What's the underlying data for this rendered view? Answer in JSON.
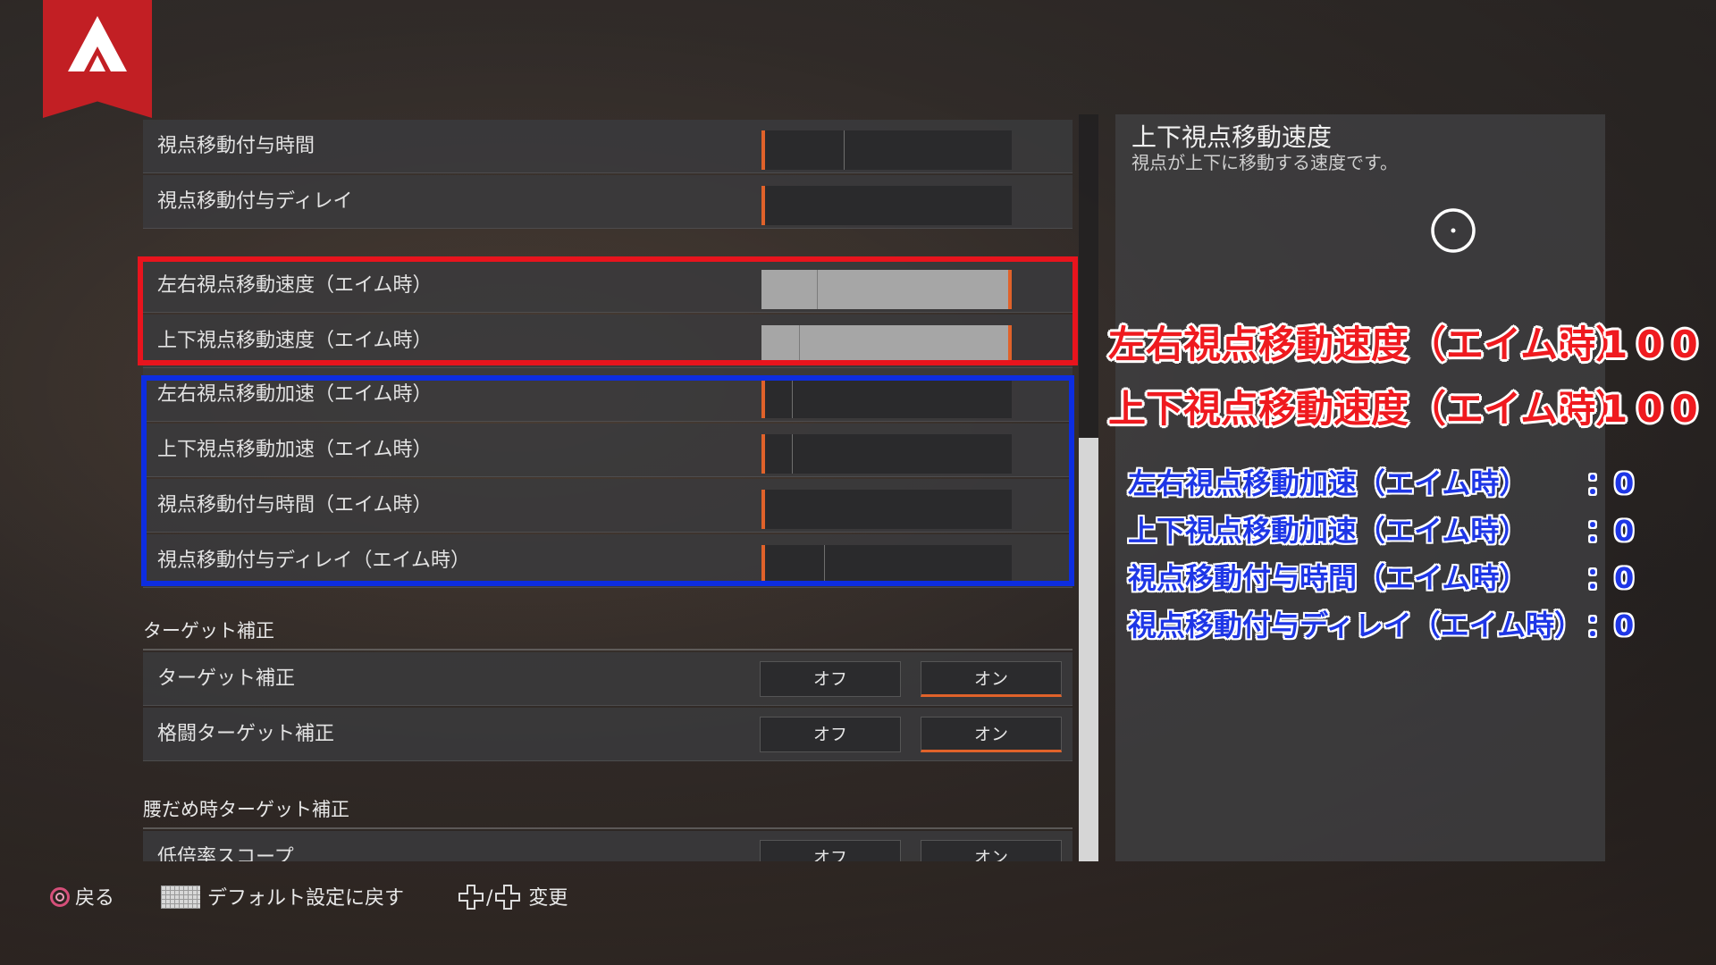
{
  "rows_top": [
    {
      "label": "視点移動付与時間",
      "value_pct": 0,
      "tick_pct": 33
    },
    {
      "label": "視点移動付与ディレイ",
      "value_pct": 0,
      "tick_pct": null
    }
  ],
  "rows_red": [
    {
      "label": "左右視点移動速度（エイム時）",
      "value_pct": 100,
      "tick_pct": 22
    },
    {
      "label": "上下視点移動速度（エイム時）",
      "value_pct": 100,
      "tick_pct": 15
    }
  ],
  "rows_blue": [
    {
      "label": "左右視点移動加速（エイム時）",
      "value_pct": 0,
      "tick_pct": 12
    },
    {
      "label": "上下視点移動加速（エイム時）",
      "value_pct": 0,
      "tick_pct": 12
    },
    {
      "label": "視点移動付与時間（エイム時）",
      "value_pct": 0,
      "tick_pct": null
    },
    {
      "label": "視点移動付与ディレイ（エイム時）",
      "value_pct": 0,
      "tick_pct": 25
    }
  ],
  "section_target": "ターゲット補正",
  "toggle_rows": [
    {
      "label": "ターゲット補正",
      "off": "オフ",
      "on": "オン",
      "selected": "on"
    },
    {
      "label": "格闘ターゲット補正",
      "off": "オフ",
      "on": "オン",
      "selected": "on"
    }
  ],
  "section_hip": "腰だめ時ターゲット補正",
  "partial_row": {
    "label": "低倍率スコープ",
    "off": "オフ",
    "on": "オン"
  },
  "panel": {
    "title": "上下視点移動速度",
    "description": "視点が上下に移動する速度です。"
  },
  "annotations_red": [
    {
      "label": "左右視点移動速度（エイム時）",
      "value": "：100"
    },
    {
      "label": "上下視点移動速度（エイム時）",
      "value": "：100"
    }
  ],
  "annotations_blue": [
    {
      "label": "左右視点移動加速（エイム時）",
      "value": "：0"
    },
    {
      "label": "上下視点移動加速（エイム時）",
      "value": "：0"
    },
    {
      "label": "視点移動付与時間（エイム時）",
      "value": "：0"
    },
    {
      "label": "視点移動付与ディレイ（エイム時）",
      "value": "：0"
    }
  ],
  "footer": {
    "back": "戻る",
    "reset": "デフォルト設定に戻す",
    "change": "変更",
    "change_sep": "/"
  },
  "colors": {
    "accent_orange": "#e0622a",
    "highlight_red": "#e8141d",
    "highlight_blue": "#0d2de0",
    "logo_red": "#c21f24"
  },
  "icons": [
    "apex-logo-icon",
    "reticle-icon",
    "circle-button-icon",
    "touchpad-icon",
    "dpad-icon"
  ]
}
